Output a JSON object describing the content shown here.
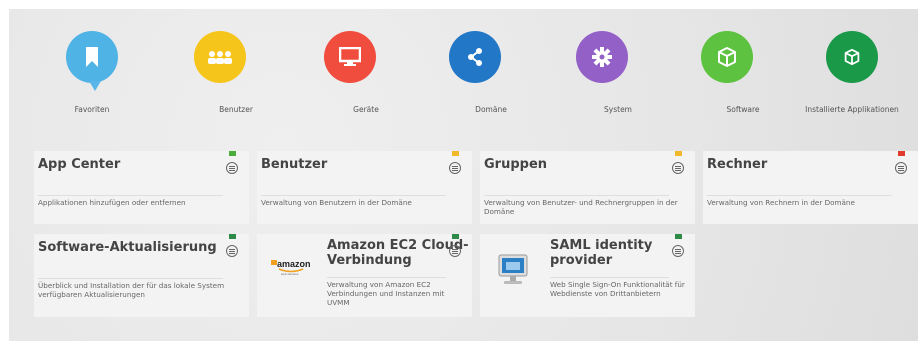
{
  "categories": [
    {
      "label": "Favoriten",
      "color": "#4fb3e6",
      "icon": "bookmark-icon"
    },
    {
      "label": "Benutzer",
      "color": "#f5c51c",
      "icon": "users-icon"
    },
    {
      "label": "Geräte",
      "color": "#f04d3e",
      "icon": "monitor-icon"
    },
    {
      "label": "Domäne",
      "color": "#2277c6",
      "icon": "network-icon"
    },
    {
      "label": "System",
      "color": "#9360c7",
      "icon": "gear-icon"
    },
    {
      "label": "Software",
      "color": "#5cc23f",
      "icon": "cube-icon"
    },
    {
      "label": "Installierte Applikationen",
      "color": "#1a9a49",
      "icon": "package-icon"
    }
  ],
  "tiles": [
    {
      "title": "App Center",
      "desc": "Applikationen hinzufügen oder entfernen",
      "flag": "#4cae3a"
    },
    {
      "title": "Benutzer",
      "desc": "Verwaltung von Benutzern in der Domäne",
      "flag": "#f0b82a"
    },
    {
      "title": "Gruppen",
      "desc": "Verwaltung von Benutzer- und Rechnergruppen in der Domäne",
      "flag": "#f0b82a"
    },
    {
      "title": "Rechner",
      "desc": "Verwaltung von Rechnern in der Domäne",
      "flag": "#e03a2f"
    },
    {
      "title": "Software-Aktualisierung",
      "desc": "Überblick und Installation der für das lokale System verfügbaren Aktualisierungen",
      "flag": "#2e8b47"
    },
    {
      "title": "Amazon EC2 Cloud-Verbindung",
      "desc": "Verwaltung von Amazon EC2 Verbindungen und Instanzen mit UVMM",
      "flag": "#2e8b47",
      "logo": "amazon"
    },
    {
      "title": "SAML identity provider",
      "desc": "Web Single Sign-On Funktionalität für Webdienste von Drittanbietern",
      "flag": "#2e8b47",
      "logo": "monitor"
    }
  ]
}
